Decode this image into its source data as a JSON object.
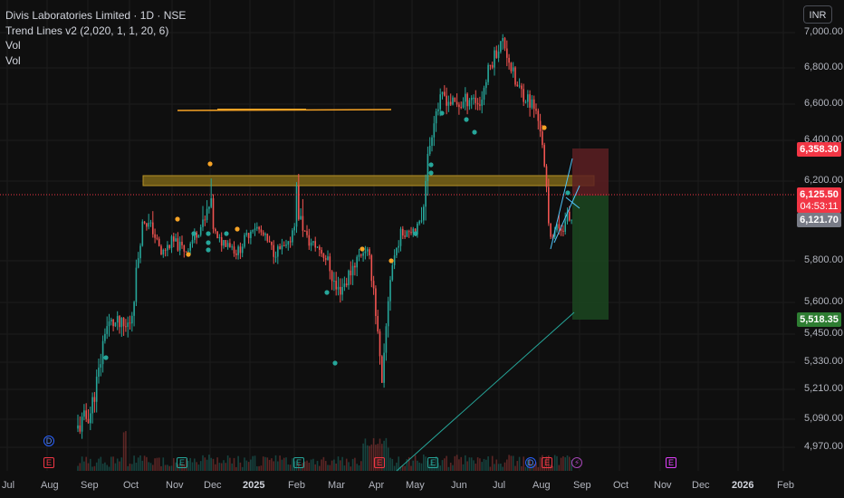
{
  "legend": {
    "title": "Divis Laboratories Limited · 1D · NSE",
    "indicator": "Trend Lines v2 (2,020, 1, 1, 20, 6)",
    "vol1": "Vol",
    "vol2": "Vol"
  },
  "currency_button": "INR",
  "y_labels": [
    "7,000.00",
    "6,800.00",
    "6,600.00",
    "6,400.00",
    "6,200.00",
    "5,800.00",
    "5,600.00",
    "5,450.00",
    "5,330.00",
    "5,210.00",
    "5,090.00",
    "4,970.00"
  ],
  "price_tags": {
    "target_high": "6,358.30",
    "current_price": "6,125.50",
    "countdown": "04:53:11",
    "prev_close": "6,121.70",
    "target_low": "5,518.35"
  },
  "x_labels": [
    "Jul",
    "Aug",
    "Sep",
    "Oct",
    "Nov",
    "Dec",
    "2025",
    "Feb",
    "Mar",
    "Apr",
    "May",
    "Jun",
    "Jul",
    "Aug",
    "Sep",
    "Oct",
    "Nov",
    "Dec",
    "2026",
    "Feb"
  ],
  "events": [
    "D",
    "E",
    "E",
    "E",
    "E",
    "E",
    "D",
    "E",
    "E",
    "E"
  ],
  "colors": {
    "up": "#26a69a",
    "down": "#ef5350",
    "level": "#f7a325",
    "zone": "#c8a12a",
    "target": "#f23645",
    "stop": "#2e7d32"
  }
}
